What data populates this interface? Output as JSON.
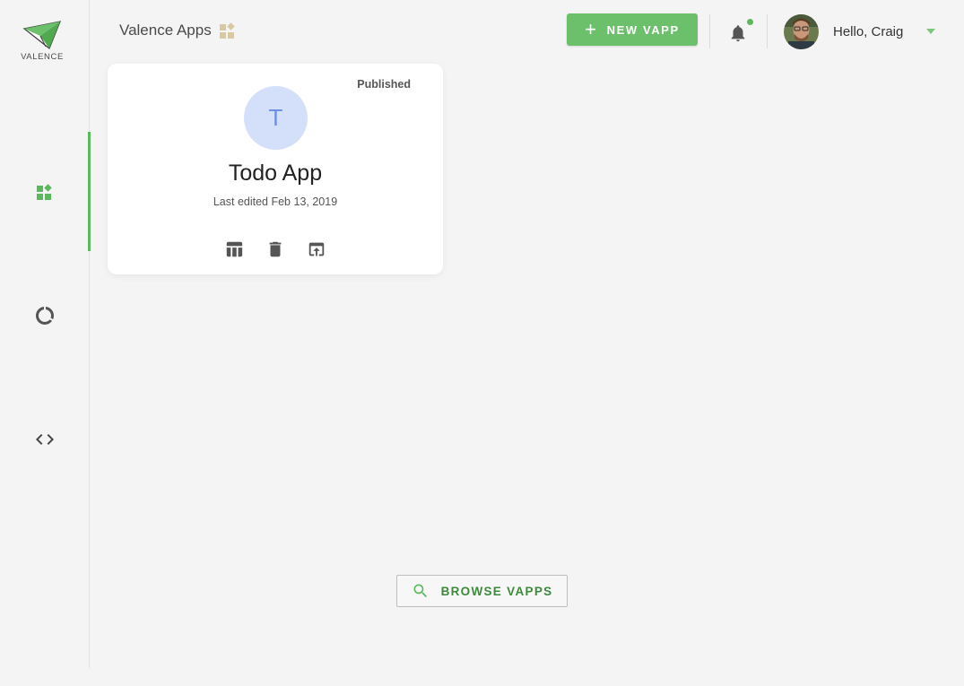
{
  "brand": {
    "logo_text": "VALENCE",
    "accent_color": "#5cb85c"
  },
  "sidebar": {
    "items": [
      {
        "name": "apps",
        "icon": "widgets-icon",
        "active": true
      },
      {
        "name": "loading",
        "icon": "progress-ring-icon",
        "active": false
      },
      {
        "name": "code",
        "icon": "code-brackets-icon",
        "active": false
      }
    ]
  },
  "header": {
    "title": "Valence Apps",
    "title_icon": "widgets-icon",
    "new_button_label": "NEW VAPP",
    "notification_icon": "bell-icon",
    "has_notification": true,
    "greeting": "Hello, Craig"
  },
  "apps": [
    {
      "initial": "T",
      "name": "Todo App",
      "status": "Published",
      "last_edited": "Last edited Feb 13, 2019",
      "actions": [
        "table-view-icon",
        "delete-icon",
        "open-in-new-icon"
      ]
    }
  ],
  "browse": {
    "label": "BROWSE VAPPS",
    "icon": "search-icon"
  }
}
